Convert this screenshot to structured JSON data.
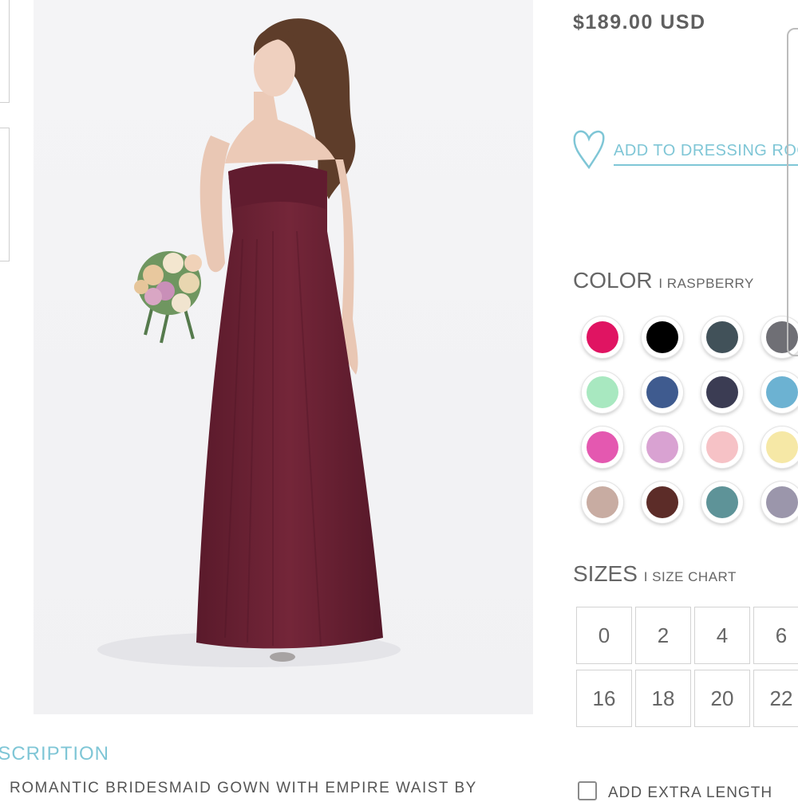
{
  "product": {
    "price": "$189.00 USD",
    "add_to_dressing_room": "ADD TO DRESSING ROOM"
  },
  "color": {
    "label": "COLOR",
    "selected": "I RASPBERRY",
    "swatches": [
      "#e01462",
      "#000000",
      "#415159",
      "#6f6f75",
      "#a8e8c0",
      "#3f5b8f",
      "#3b3c53",
      "#6cb2d2",
      "#e458b0",
      "#d9a2d2",
      "#f6c2c6",
      "#f6e8a6",
      "#c8aca2",
      "#5c2c28",
      "#5e9398",
      "#9b96ab"
    ]
  },
  "sizes": {
    "label": "SIZES",
    "chart_link": "I SIZE CHART",
    "values": [
      "0",
      "2",
      "4",
      "6",
      "16",
      "18",
      "20",
      "22"
    ]
  },
  "description": {
    "heading": "DESCRIPTION",
    "text": "ROMANTIC BRIDESMAID GOWN WITH EMPIRE WAIST BY"
  },
  "options": {
    "extra_length": "ADD EXTRA LENGTH"
  },
  "colors": {
    "accent": "#7fc6d6",
    "dress": "#6e2236"
  }
}
